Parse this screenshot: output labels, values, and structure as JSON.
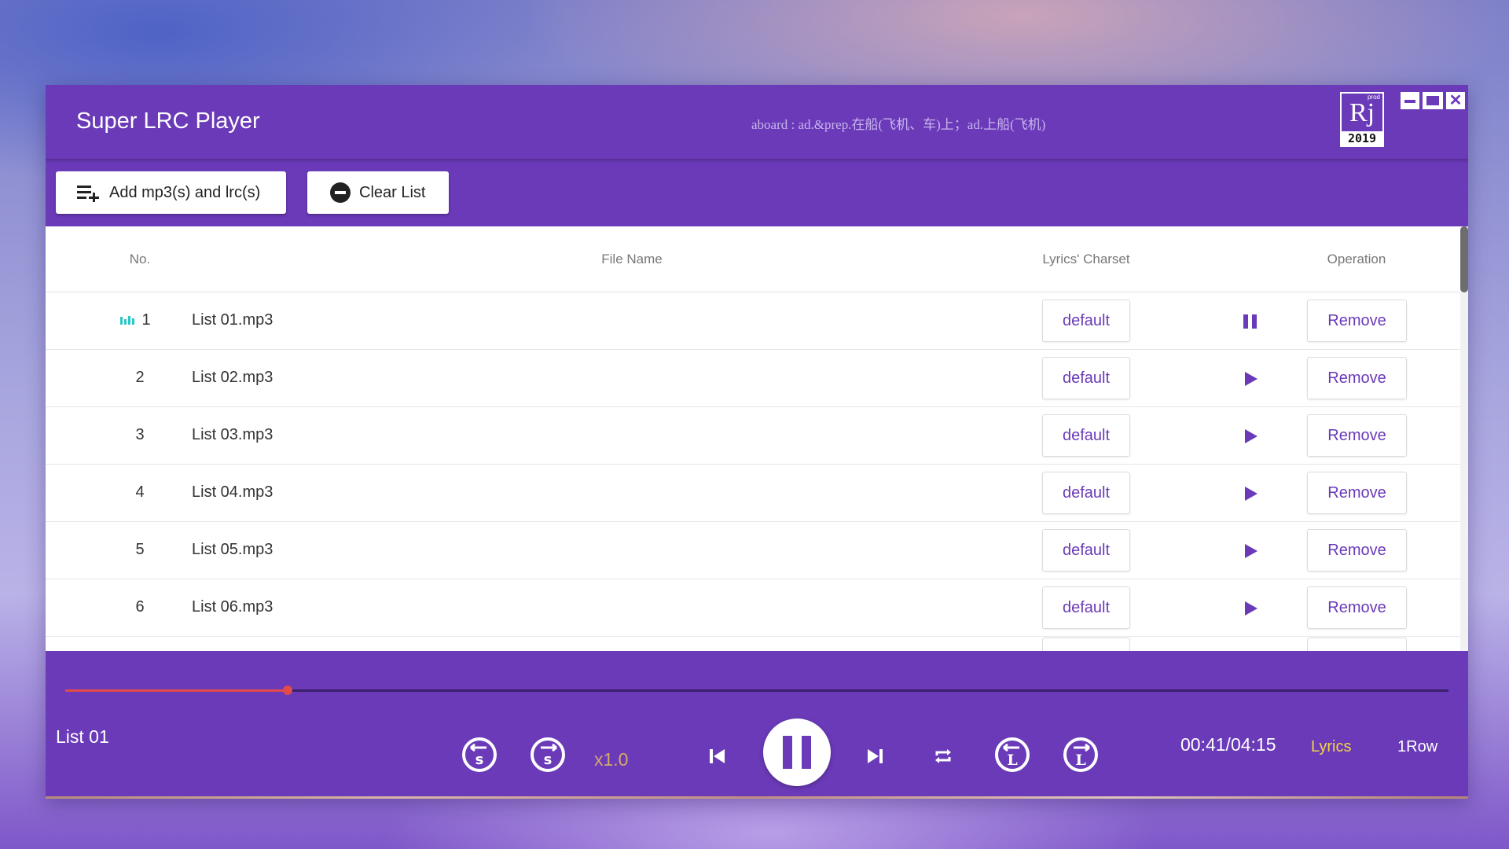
{
  "header": {
    "app_title": "Super LRC Player",
    "lyric_hint": "aboard : ad.&prep.在船(飞机、车)上；ad.上船(飞机)",
    "logo": {
      "text": "Rj",
      "prod": "prod",
      "year": "2019"
    }
  },
  "toolbar": {
    "add_label": "Add mp3(s) and lrc(s)",
    "clear_label": "Clear List"
  },
  "table": {
    "headers": {
      "no": "No.",
      "file_name": "File Name",
      "charset": "Lyrics' Charset",
      "operation": "Operation"
    },
    "rows": [
      {
        "no": "1",
        "name": "List 01.mp3",
        "charset": "default",
        "state": "playing",
        "remove": "Remove"
      },
      {
        "no": "2",
        "name": "List 02.mp3",
        "charset": "default",
        "state": "stopped",
        "remove": "Remove"
      },
      {
        "no": "3",
        "name": "List 03.mp3",
        "charset": "default",
        "state": "stopped",
        "remove": "Remove"
      },
      {
        "no": "4",
        "name": "List 04.mp3",
        "charset": "default",
        "state": "stopped",
        "remove": "Remove"
      },
      {
        "no": "5",
        "name": "List 05.mp3",
        "charset": "default",
        "state": "stopped",
        "remove": "Remove"
      },
      {
        "no": "6",
        "name": "List 06.mp3",
        "charset": "default",
        "state": "stopped",
        "remove": "Remove"
      }
    ]
  },
  "player": {
    "now_playing": "List 01",
    "progress": 0.161,
    "speed": "x1.0",
    "time": "00:41/04:15",
    "lyrics_label": "Lyrics",
    "row_mode_label": "1Row"
  },
  "colors": {
    "primary": "#6a3ab8",
    "progress": "#e24b4b",
    "lyrics_accent": "#f5d54b",
    "speed_text": "#d6a96b",
    "playing_indicator": "#2bc6c6"
  },
  "icons": {
    "add": "playlist-add-icon",
    "clear": "minus-circle-icon",
    "play": "play-icon",
    "pause": "pause-icon",
    "prev": "skip-previous-icon",
    "next": "skip-next-icon",
    "repeat": "repeat-icon",
    "sub_back": "subtitle-back-icon",
    "sub_forward": "subtitle-forward-icon",
    "lyric_back": "lyric-back-icon",
    "lyric_forward": "lyric-forward-icon"
  }
}
